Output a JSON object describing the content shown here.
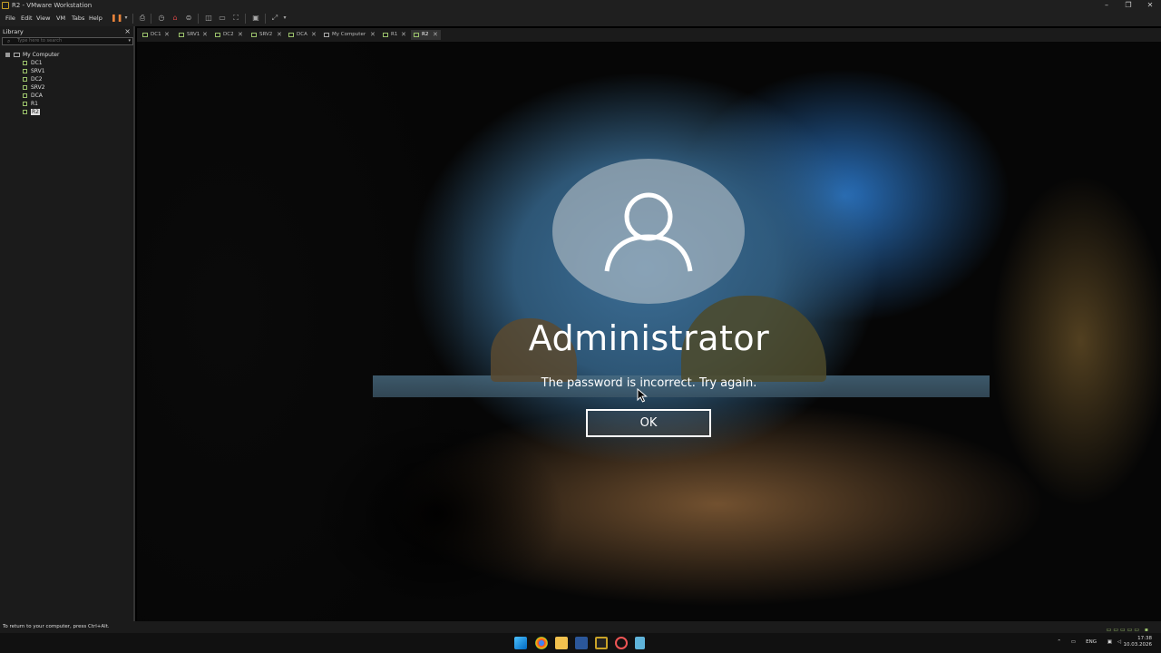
{
  "window": {
    "title": "R2 - VMware Workstation",
    "min": "–",
    "restore": "❐",
    "close": "✕"
  },
  "menu": {
    "file": "File",
    "edit": "Edit",
    "view": "View",
    "vm": "VM",
    "tabs": "Tabs",
    "help": "Help"
  },
  "library": {
    "header": "Library",
    "close": "×",
    "search_placeholder": "Type here to search",
    "root": "My Computer",
    "items": [
      "DC1",
      "SRV1",
      "DC2",
      "SRV2",
      "DCA",
      "R1",
      "R2"
    ]
  },
  "tabs": [
    {
      "label": "DC1",
      "close": "✕"
    },
    {
      "label": "SRV1",
      "close": "✕"
    },
    {
      "label": "DC2",
      "close": "✕"
    },
    {
      "label": "SRV2",
      "close": "✕"
    },
    {
      "label": "DCA",
      "close": "✕"
    },
    {
      "label": "My Computer",
      "close": "✕"
    },
    {
      "label": "R1",
      "close": "✕"
    },
    {
      "label": "R2",
      "close": "✕"
    }
  ],
  "login": {
    "username": "Administrator",
    "message": "The password is incorrect. Try again.",
    "ok": "OK"
  },
  "status": {
    "text": "To return to your computer, press Ctrl+Alt."
  },
  "tray": {
    "lang": "ENG",
    "time": "17:38",
    "date": "10.03.2026"
  }
}
